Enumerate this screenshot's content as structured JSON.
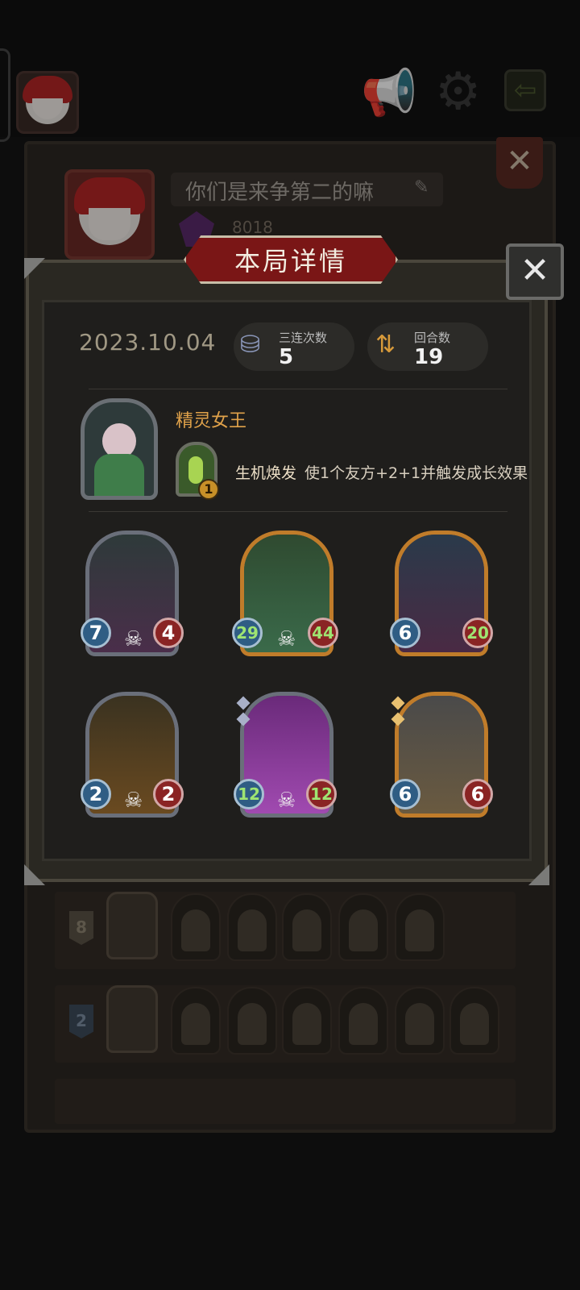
{
  "profile": {
    "name": "你们是来争第二的嘛",
    "score": "8018"
  },
  "modal": {
    "title": "本局详情",
    "date": "2023.10.04",
    "stats": [
      {
        "label": "三连次数",
        "value": "5"
      },
      {
        "label": "回合数",
        "value": "19"
      }
    ],
    "hero": {
      "name": "精灵女王",
      "skill_cost": "1",
      "skill_name": "生机焕发",
      "skill_desc": "使1个友方+2+1并触发成长效果"
    },
    "units": [
      {
        "attack": "7",
        "health": "4",
        "frame": "silver",
        "attack_buffed": false,
        "health_buffed": false,
        "skull": true
      },
      {
        "attack": "29",
        "health": "44",
        "frame": "gold",
        "attack_buffed": true,
        "health_buffed": true,
        "skull": true
      },
      {
        "attack": "6",
        "health": "20",
        "frame": "gold",
        "attack_buffed": false,
        "health_buffed": true,
        "skull": false
      },
      {
        "attack": "2",
        "health": "2",
        "frame": "silver",
        "attack_buffed": false,
        "health_buffed": false,
        "skull": true
      },
      {
        "attack": "12",
        "health": "12",
        "frame": "silver",
        "attack_buffed": true,
        "health_buffed": true,
        "skull": true
      },
      {
        "attack": "6",
        "health": "6",
        "frame": "gold",
        "attack_buffed": false,
        "health_buffed": false,
        "skull": false
      }
    ]
  },
  "history": [
    {
      "rank": "8"
    },
    {
      "rank": "2"
    }
  ],
  "colors": {
    "banner": "#7a1616",
    "hero_name": "#e0a24a",
    "buff_green": "#9fe572"
  }
}
